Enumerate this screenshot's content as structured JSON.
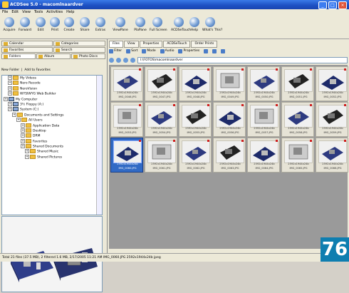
{
  "window": {
    "title": "ACDSee 5.0 - macomlnaardver"
  },
  "menu": [
    "File",
    "Edit",
    "View",
    "Tools",
    "Activities",
    "Help"
  ],
  "toolbar": [
    "Acquire",
    "Forward",
    "Edit",
    "Print",
    "Create",
    "Share",
    "Extras",
    "ViewPane",
    "PlaPane",
    "Full Screen",
    "ACDSeTouch",
    "Help",
    "What's This?"
  ],
  "left_tabs": [
    "Calendar",
    "Categories",
    "Favorites",
    "Search",
    "Folders",
    "Album",
    "Photo Discs"
  ],
  "left_new_folder": "New Folder",
  "left_add_fav": "Add to Favorites",
  "tree": [
    {
      "label": "My Videos",
      "lvl": 1,
      "t": "f"
    },
    {
      "label": "Nero Recode",
      "lvl": 1,
      "t": "f"
    },
    {
      "label": "NeroVision",
      "lvl": 1,
      "t": "f"
    },
    {
      "label": "WYSIWYG Web Builder",
      "lvl": 1,
      "t": "f"
    },
    {
      "label": "My Computer",
      "lvl": 0,
      "t": "pc"
    },
    {
      "label": "3½ Floppy (A:)",
      "lvl": 1,
      "t": "pc"
    },
    {
      "label": "System (C:)",
      "lvl": 1,
      "t": "pc"
    },
    {
      "label": "Documents and Settings",
      "lvl": 2,
      "t": "f"
    },
    {
      "label": "All Users",
      "lvl": 3,
      "t": "f"
    },
    {
      "label": "Application Data",
      "lvl": 4,
      "t": "f"
    },
    {
      "label": "Desktop",
      "lvl": 4,
      "t": "f"
    },
    {
      "label": "DRM",
      "lvl": 4,
      "t": "f"
    },
    {
      "label": "Favorites",
      "lvl": 4,
      "t": "f"
    },
    {
      "label": "Shared Documents",
      "lvl": 4,
      "t": "f"
    },
    {
      "label": "Shared Music",
      "lvl": 5,
      "t": "f"
    },
    {
      "label": "Shared Pictures",
      "lvl": 5,
      "t": "f"
    }
  ],
  "right_tabs": [
    "Files",
    "View",
    "Properties",
    "ACDSeTouch",
    "Order Prints"
  ],
  "right_tools": [
    "Filter",
    "Sort",
    "Mode",
    "Audio",
    "Properties"
  ],
  "address": "I:\\FOTOS\\macomlnaardver",
  "thumb_dim": "2592x1944x24b",
  "thumbs": [
    "IMG_0046.JPG",
    "IMG_0047.JPG",
    "IMG_0048.JPG",
    "IMG_0049.JPG",
    "IMG_0050.JPG",
    "IMG_0051.JPG",
    "IMG_0052.JPG",
    "IMG_0053.JPG",
    "IMG_0054.JPG",
    "IMG_0055.JPG",
    "IMG_0056.JPG",
    "IMG_0057.JPG",
    "IMG_0058.JPG",
    "IMG_0059.JPG",
    "IMG_0060.JPG",
    "IMG_0061.JPG",
    "IMG_0062.JPG",
    "IMG_0063.JPG",
    "IMG_0064.JPG",
    "IMG_0065.JPG",
    "IMG_0066.JPG"
  ],
  "selected_thumb": "IMG_0060.JPG",
  "status": "Total 21 files (37.5 MB), 2 filtered   1.6 MB, 2/17/2005 11:21 AM   IMG_0060.JPG   2592x1944x24b jpeg",
  "page_number": "76"
}
